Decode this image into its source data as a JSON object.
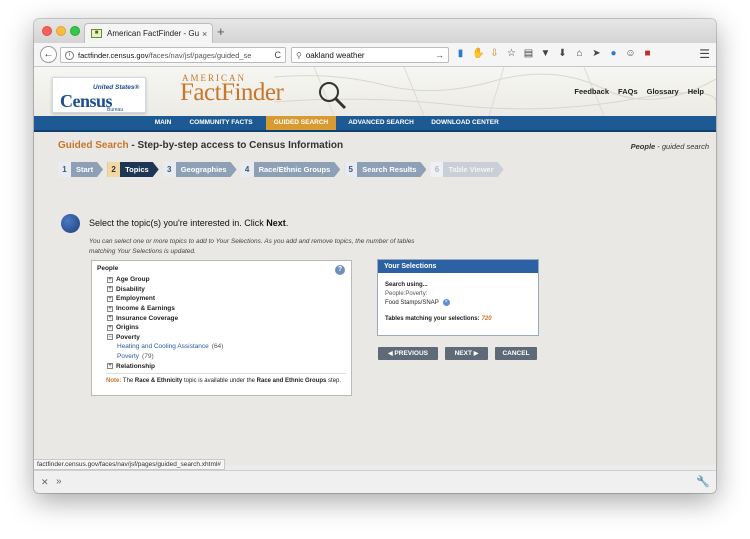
{
  "browser": {
    "tab_title": "American FactFinder - Guid...",
    "tab_close": "×",
    "new_tab": "+",
    "url_host": "factfinder.census.gov",
    "url_path": "/faces/nav/jsf/pages/guided_se",
    "reload": "C",
    "search_value": "oakland weather",
    "search_go": "→",
    "toolbar_icons": [
      "reading-list-icon",
      "grab-icon",
      "download-icon",
      "star-icon",
      "clipboard-icon",
      "pocket-icon",
      "arrow-down-icon",
      "home-icon",
      "send-icon",
      "drop-icon",
      "emoji-icon",
      "addon-icon"
    ],
    "menu": "☰",
    "status_url": "factfinder.census.gov/faces/nav/jsf/pages/guided_search.xhtml#"
  },
  "header": {
    "logo_us": "United States®",
    "logo_census": "Census",
    "logo_bureau": "Bureau",
    "brand_small": "AMERICAN",
    "brand_main": "FactFinder",
    "links": [
      "Feedback",
      "FAQs",
      "Glossary",
      "Help"
    ]
  },
  "mainnav": {
    "items": [
      "MAIN",
      "COMMUNITY FACTS",
      "GUIDED SEARCH",
      "ADVANCED SEARCH",
      "DOWNLOAD CENTER"
    ],
    "active": "GUIDED SEARCH"
  },
  "guided": {
    "title_accent": "Guided Search",
    "title_rest": " - Step-by-step access to Census Information",
    "right_bold": "People",
    "right_rest": " - guided search",
    "steps": [
      {
        "num": "1",
        "label": "Start"
      },
      {
        "num": "2",
        "label": "Topics"
      },
      {
        "num": "3",
        "label": "Geographies"
      },
      {
        "num": "4",
        "label": "Race/Ethnic Groups"
      },
      {
        "num": "5",
        "label": "Search Results"
      },
      {
        "num": "6",
        "label": "Table Viewer"
      }
    ],
    "heading_pre": "Select the topic(s) you're interested in. Click ",
    "heading_bold": "Next",
    "heading_post": ".",
    "description": "You can select one or more topics to add to Your Selections. As you add and remove topics, the number of tables matching Your Selections is updated."
  },
  "topics": {
    "root": "People",
    "items": [
      "Age Group",
      "Disability",
      "Employment",
      "Income & Earnings",
      "Insurance Coverage",
      "Origins",
      "Poverty",
      "Relationship"
    ],
    "expanded": "Poverty",
    "subitems": [
      {
        "label": "Heating and Cooling Assistance",
        "count": "(64)"
      },
      {
        "label": "Poverty",
        "count": "(79)"
      }
    ],
    "note_label": "Note:",
    "note_text_1": " The ",
    "note_bold_1": "Race & Ethnicity",
    "note_text_2": " topic is available under the ",
    "note_bold_2": "Race and Ethnic Groups",
    "note_text_3": " step.",
    "help": "?"
  },
  "selections": {
    "title": "Your Selections",
    "using": "Search using...",
    "path": "People:Poverty:",
    "item": "Food Stamps/SNAP",
    "remove": "×",
    "count_label": "Tables matching your selections:",
    "count_value": "720"
  },
  "buttons": {
    "previous": "PREVIOUS",
    "next": "NEXT",
    "cancel": "CANCEL"
  },
  "colors": {
    "accent": "#c9762b",
    "nav_blue": "#1d5a94",
    "nav_active": "#d89b32",
    "step_current": "#1e3553"
  }
}
